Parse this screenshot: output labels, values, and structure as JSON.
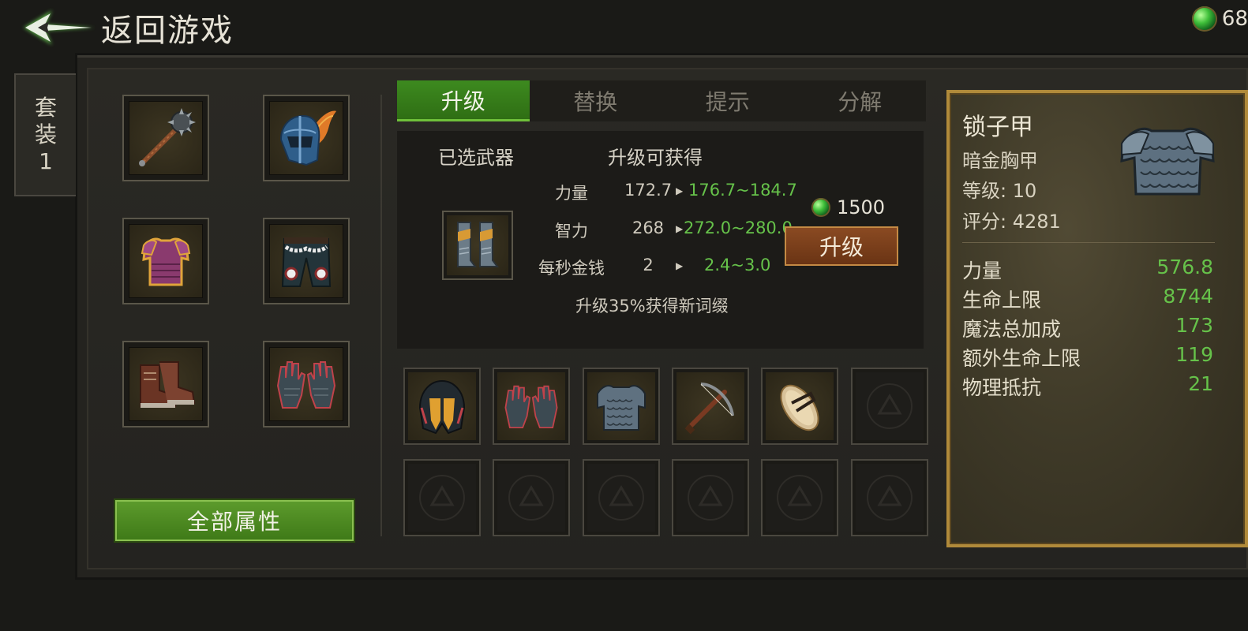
{
  "header": {
    "back_label": "返回游戏",
    "currency_value": "68"
  },
  "set_tab": {
    "line1": "套",
    "line2": "装",
    "line3": "1"
  },
  "equipped": [
    {
      "name": "mace",
      "icon": "mace-icon"
    },
    {
      "name": "winged-helmet",
      "icon": "winged-helmet-icon"
    },
    {
      "name": "purple-armor",
      "icon": "purple-armor-icon"
    },
    {
      "name": "dark-pants",
      "icon": "pants-icon"
    },
    {
      "name": "brown-boots",
      "icon": "boots-icon"
    },
    {
      "name": "chain-gloves",
      "icon": "gloves-icon"
    }
  ],
  "all_attributes_label": "全部属性",
  "tabs": [
    {
      "label": "升级",
      "active": true
    },
    {
      "label": "替换",
      "active": false
    },
    {
      "label": "提示",
      "active": false
    },
    {
      "label": "分解",
      "active": false
    }
  ],
  "upgrade": {
    "selected_label": "已选武器",
    "gain_label": "升级可获得",
    "stats": [
      {
        "name": "力量",
        "current": "172.7",
        "new": "176.7~184.7"
      },
      {
        "name": "智力",
        "current": "268",
        "new": "272.0~280.0"
      },
      {
        "name": "每秒金钱",
        "current": "2",
        "new": "2.4~3.0"
      }
    ],
    "cost": "1500",
    "button_label": "升级",
    "note": "升级35%获得新词缀"
  },
  "inventory": [
    {
      "icon": "dark-helmet-icon",
      "empty": false
    },
    {
      "icon": "gloves-icon",
      "empty": false
    },
    {
      "icon": "chainmail-icon",
      "empty": false
    },
    {
      "icon": "crossbow-icon",
      "empty": false
    },
    {
      "icon": "sandal-icon",
      "empty": false
    },
    {
      "icon": "empty-slot-icon",
      "empty": true
    }
  ],
  "detail": {
    "name": "锁子甲",
    "type": "暗金胸甲",
    "level": "等级: 10",
    "score": "评分: 4281",
    "stats": [
      {
        "name": "力量",
        "value": "576.8"
      },
      {
        "name": "生命上限",
        "value": "8744"
      },
      {
        "name": "魔法总加成",
        "value": "173"
      },
      {
        "name": "额外生命上限",
        "value": "119"
      },
      {
        "name": "物理抵抗",
        "value": "21"
      }
    ]
  },
  "colors": {
    "accent_green": "#66c24a",
    "gold_border": "#b08a3a",
    "upgrade_brown": "#8a4a22"
  }
}
